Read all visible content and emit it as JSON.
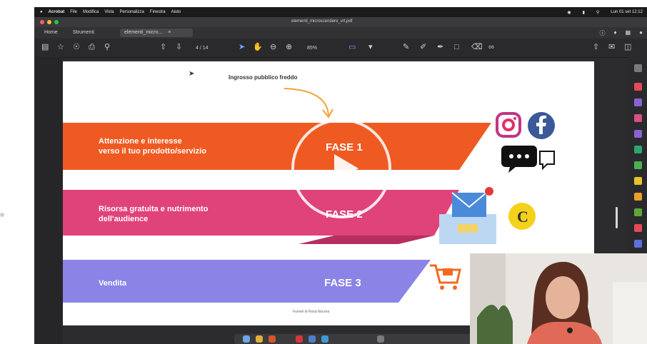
{
  "menubar": {
    "items": [
      "Acrobat",
      "File",
      "Modifica",
      "Vista",
      "Personalizza",
      "Finestra",
      "Aiuto"
    ],
    "clock": "Lun 01 set 12:12"
  },
  "window": {
    "title": "elementi_microscendere_vrt.pdf"
  },
  "tabs": [
    {
      "label": "Home",
      "active": false
    },
    {
      "label": "Strumenti",
      "active": false
    },
    {
      "label": "elementi_micro...",
      "active": true
    }
  ],
  "toolbar": {
    "page_indicator": "4 / 14",
    "zoom": "85%"
  },
  "slide": {
    "note": "Ingrosso pubblico freddo",
    "bands": [
      {
        "label_line1": "Attenzione e interesse",
        "label_line2": "verso il tuo prodotto/servizio",
        "phase": "FASE 1"
      },
      {
        "label_line1": "Risorsa gratuita e nutrimento",
        "label_line2": "dell'audience",
        "phase": "FASE 2"
      },
      {
        "label_line1": "Vendita",
        "label_line2": "",
        "phase": "FASE 3"
      }
    ],
    "footer": "Funnel di Rosa Nocera"
  },
  "colors": {
    "band1": "#ef5a22",
    "band2": "#e0427a",
    "band3": "#8b83e6",
    "instagram": "#c13584",
    "facebook": "#3b5998",
    "mail": "#4a8ad9",
    "coin": "#f4d21b",
    "cart": "#f26a21"
  },
  "icons": [
    "instagram-icon",
    "facebook-icon",
    "chat-icon",
    "mail-icon",
    "coin-icon",
    "cart-icon",
    "play-icon"
  ]
}
